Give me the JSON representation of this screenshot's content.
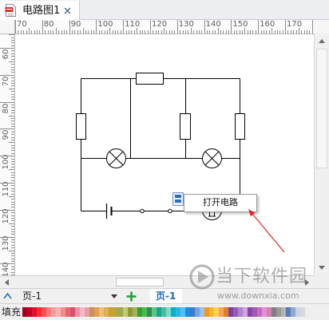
{
  "window": {
    "tab": {
      "title": "电路图1",
      "icon": "visio-document-icon",
      "close_icon": "close-icon"
    }
  },
  "ruler": {
    "horizontal_labels": [
      "70",
      "80",
      "90",
      "100",
      "110",
      "120",
      "130",
      "140",
      "150",
      "160",
      "170"
    ],
    "vertical_labels": [
      "60",
      "70",
      "80",
      "90",
      "100",
      "110",
      "120",
      "130",
      "140"
    ]
  },
  "context_menu": {
    "trigger_icon": "smart-tag-icon",
    "items": [
      {
        "label": "打开电路"
      }
    ]
  },
  "scrollbars": {
    "vertical": {
      "up_icon": "scroll-up-arrow-icon",
      "down_icon": "scroll-down-arrow-icon"
    },
    "horizontal": {
      "left_icon": "scroll-left-arrow-icon",
      "right_icon": "scroll-right-arrow-icon"
    }
  },
  "page_bar": {
    "collapse_icon": "chevron-up-icon",
    "page_select": {
      "value": "页-1",
      "icon": "dropdown-arrow-icon"
    },
    "add_page_icon": "plus-icon",
    "tabs": [
      {
        "label": "页-1",
        "active": true
      }
    ],
    "active_tab_color": "#1d6bc6"
  },
  "fill_palette": {
    "label": "填充",
    "colors": [
      "#a50021",
      "#c0001f",
      "#e0112b",
      "#ff2a2a",
      "#ff5050",
      "#ff7c80",
      "#ff9999",
      "#ffb3b3",
      "#f58c8c",
      "#e26b6b",
      "#d94f70",
      "#f08fa8",
      "#f9b7c6",
      "#e9a0a0",
      "#cc8d5a",
      "#e0a05a",
      "#f2bf6e",
      "#d9b15a",
      "#c9a227",
      "#b5a642",
      "#9fa84a",
      "#c4c970",
      "#8c9a3a",
      "#a8b060",
      "#33a02c",
      "#4cbb4c",
      "#2e8b57",
      "#5cc58a",
      "#1aa38a",
      "#3fc1a8",
      "#7fd8c4",
      "#00b0c8",
      "#2bb5e8",
      "#4fc3f7",
      "#1e88e5",
      "#3d7cc9",
      "#6fa3e0",
      "#9cc1ec",
      "#f39a1e",
      "#f7b731",
      "#ffd24d",
      "#f4a460",
      "#e67e22",
      "#7b3fa0",
      "#9b59b6",
      "#b084cc",
      "#c9a6e0",
      "#8e44ad",
      "#a05ca8",
      "#c96bc0",
      "#e08fd8",
      "#d47fae",
      "#7f7f7f",
      "#999999",
      "#b3b3b3",
      "#5b7bb5",
      "#8fa8d0",
      "#c8d4e8",
      "#d9d9d9",
      "#ececec"
    ]
  },
  "annotation": {
    "arrow_color": "#e02424"
  },
  "watermark": {
    "logo": "downxia-logo-icon",
    "brand": "当下软件园",
    "url": "www.downxia.com"
  }
}
